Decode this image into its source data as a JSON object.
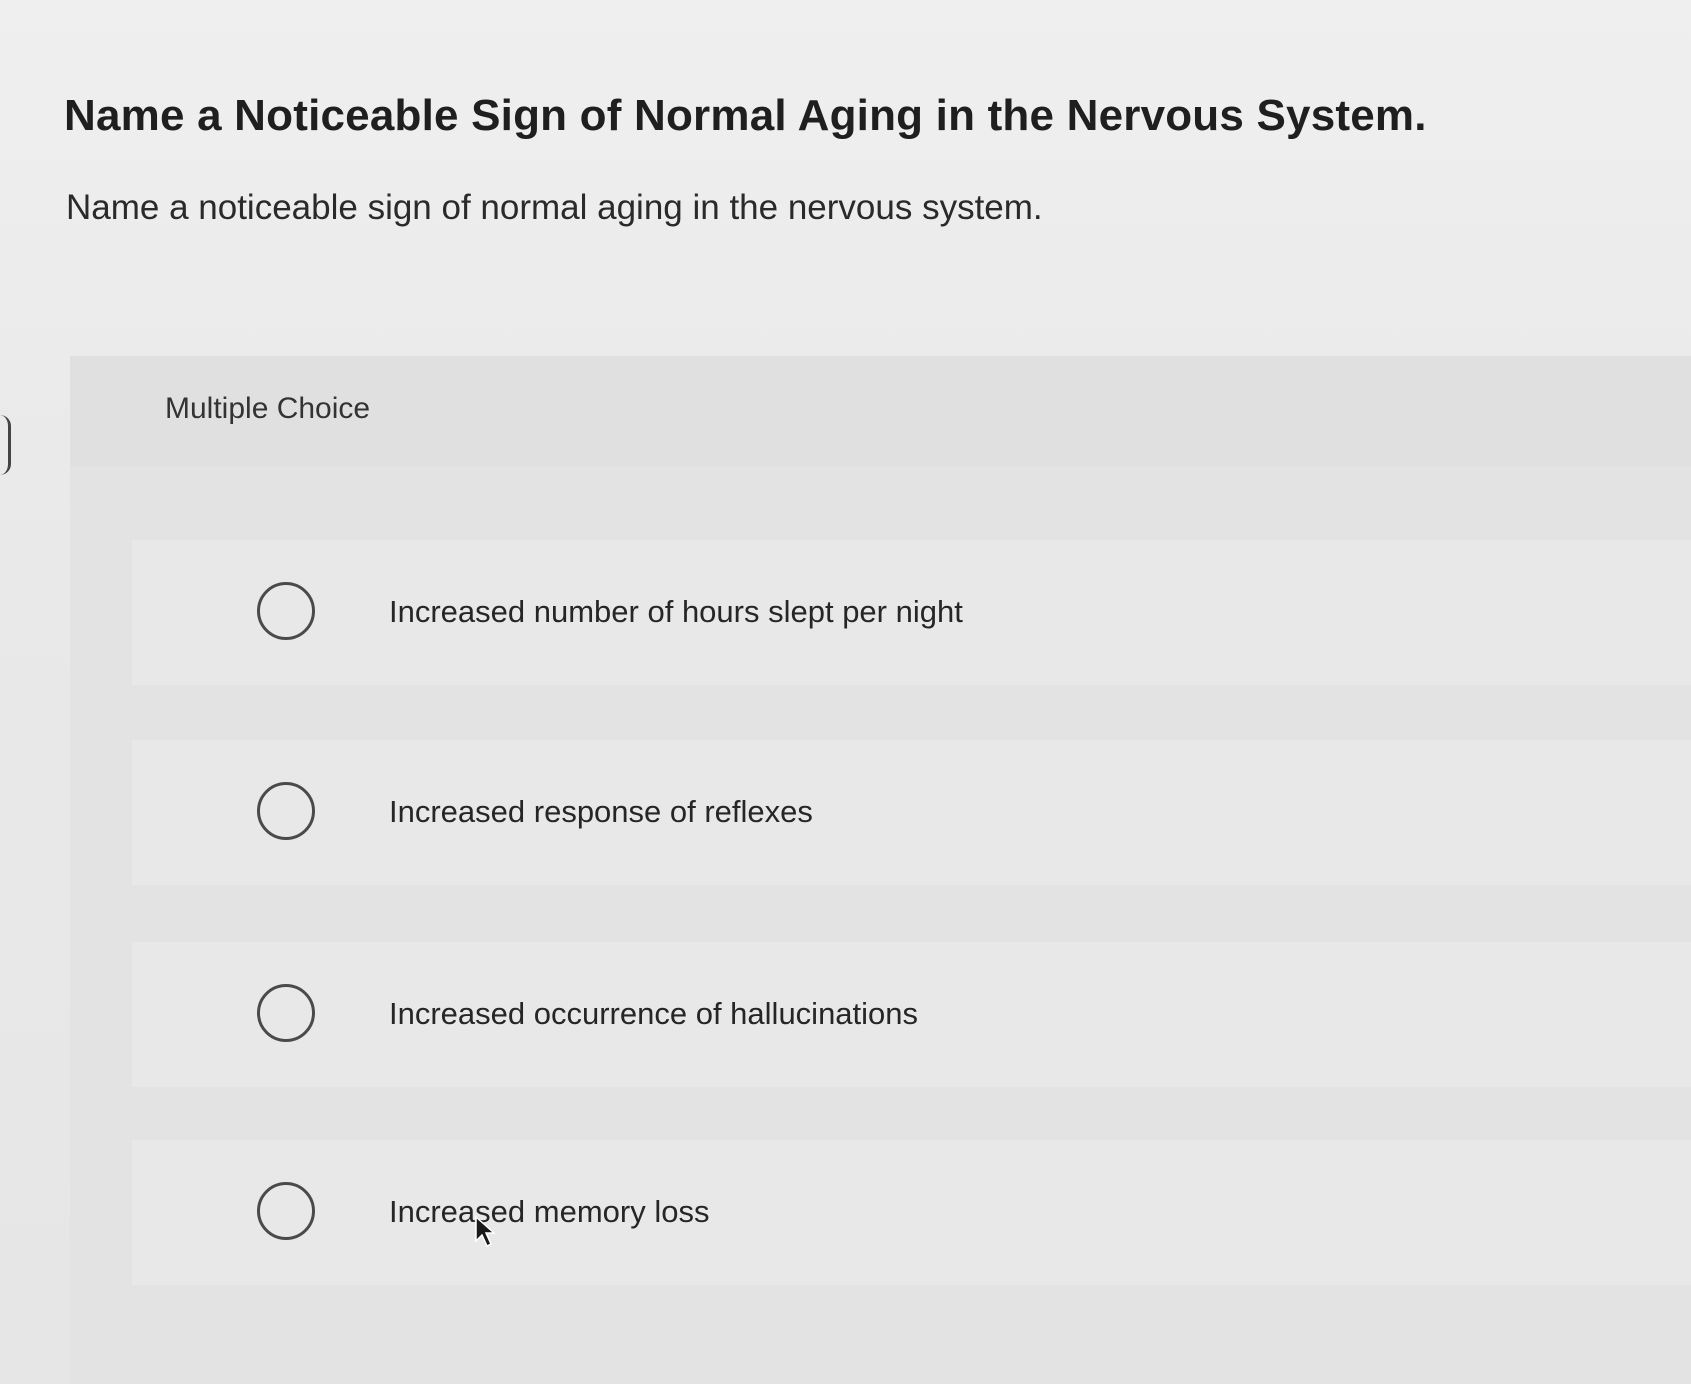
{
  "question": {
    "title": "Name a Noticeable Sign of Normal Aging in the Nervous System.",
    "prompt": "Name a noticeable sign of normal aging in the nervous system."
  },
  "multiple_choice": {
    "label": "Multiple Choice",
    "options": [
      {
        "label": "Increased number of hours slept per night",
        "selected": false
      },
      {
        "label": "Increased response of reflexes",
        "selected": false
      },
      {
        "label": "Increased occurrence of hallucinations",
        "selected": false
      },
      {
        "label": "Increased memory loss",
        "selected": false
      }
    ]
  },
  "icons": {
    "radio": "radio-unchecked-icon",
    "cursor": "mouse-pointer-icon"
  }
}
